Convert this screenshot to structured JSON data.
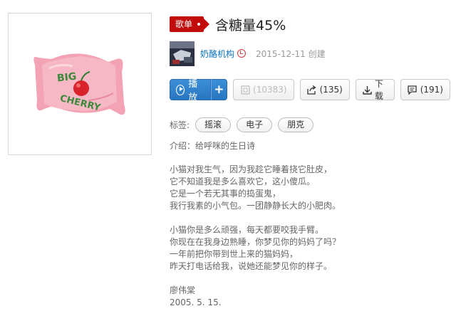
{
  "playlist": {
    "badge": "歌单",
    "title": "含糖量45%",
    "cover_text": [
      "BIG",
      "CHERRY"
    ],
    "creator": "奶酪机构",
    "create_date": "2015-12-11 创建"
  },
  "actions": {
    "play": "播放",
    "add": "+",
    "collect_count": "(10383)",
    "share_count": "(135)",
    "download": "下载",
    "comment_count": "(191)"
  },
  "tags": {
    "label": "标签:",
    "items": [
      "摇滚",
      "电子",
      "朋克"
    ]
  },
  "intro": "介绍：给呼咪的生日诗",
  "description": [
    [
      "小猫对我生气，因为我趁它睡着挠它肚皮，",
      "它不知道我是多么喜欢它，这小傻瓜。",
      "它是一个若无其事的捣蛋鬼，",
      "我行我素的小气包。一团静静长大的小肥肉。"
    ],
    [
      "小猫你是多么顽强，每天都要咬我手臂。",
      "你现在在我身边熟睡，你梦见你的妈妈了吗？",
      "一年前把你带到世上来的猫妈妈，",
      "昨天打电话给我，说她还能梦见你的样子。"
    ],
    [
      "廖伟棠",
      "2005. 5. 15."
    ]
  ]
}
